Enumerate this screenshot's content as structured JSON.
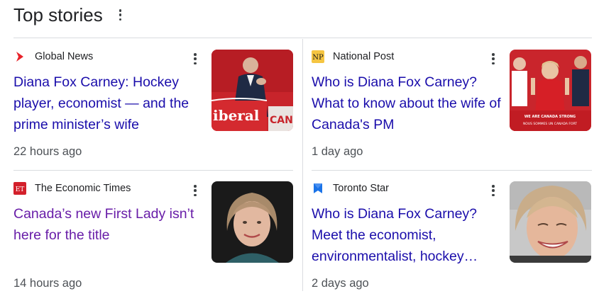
{
  "section": {
    "title": "Top stories"
  },
  "stories": [
    {
      "source": "Global News",
      "source_logo": "global-news-logo",
      "headline": "Diana Fox Carney: Hockey player, economist — and the prime minister’s wife",
      "age": "22 hours ago",
      "thumbnail": "man-at-liberal-podium-photo",
      "thumb_text": [
        "iberal",
        "CAN"
      ],
      "visited": false
    },
    {
      "source": "National Post",
      "source_logo": "national-post-logo",
      "source_logo_text": "NP",
      "headline": "Who is Diana Fox Carney? What to know about the wife of Canada's PM",
      "age": "1 day ago",
      "thumbnail": "woman-cheering-rally-photo",
      "thumb_text": [
        "WE ARE CANADA STRONG",
        "NOUS SOMMES UN CANADA FORT"
      ],
      "visited": false
    },
    {
      "source": "The Economic Times",
      "source_logo": "economic-times-logo",
      "source_logo_text": "ET",
      "headline": "Canada’s new First Lady isn’t here for the title",
      "age": "14 hours ago",
      "thumbnail": "woman-portrait-photo",
      "visited": true
    },
    {
      "source": "Toronto Star",
      "source_logo": "toronto-star-logo",
      "headline": "Who is Diana Fox Carney? Meet the economist, environmentalist, hockey…",
      "age": "2 days ago",
      "thumbnail": "woman-smiling-closeup-photo",
      "visited": false
    }
  ],
  "colors": {
    "headline_link": "#1a0dab",
    "headline_visited": "#681da8",
    "meta_text": "#4d5156",
    "divider": "#dadce0"
  }
}
